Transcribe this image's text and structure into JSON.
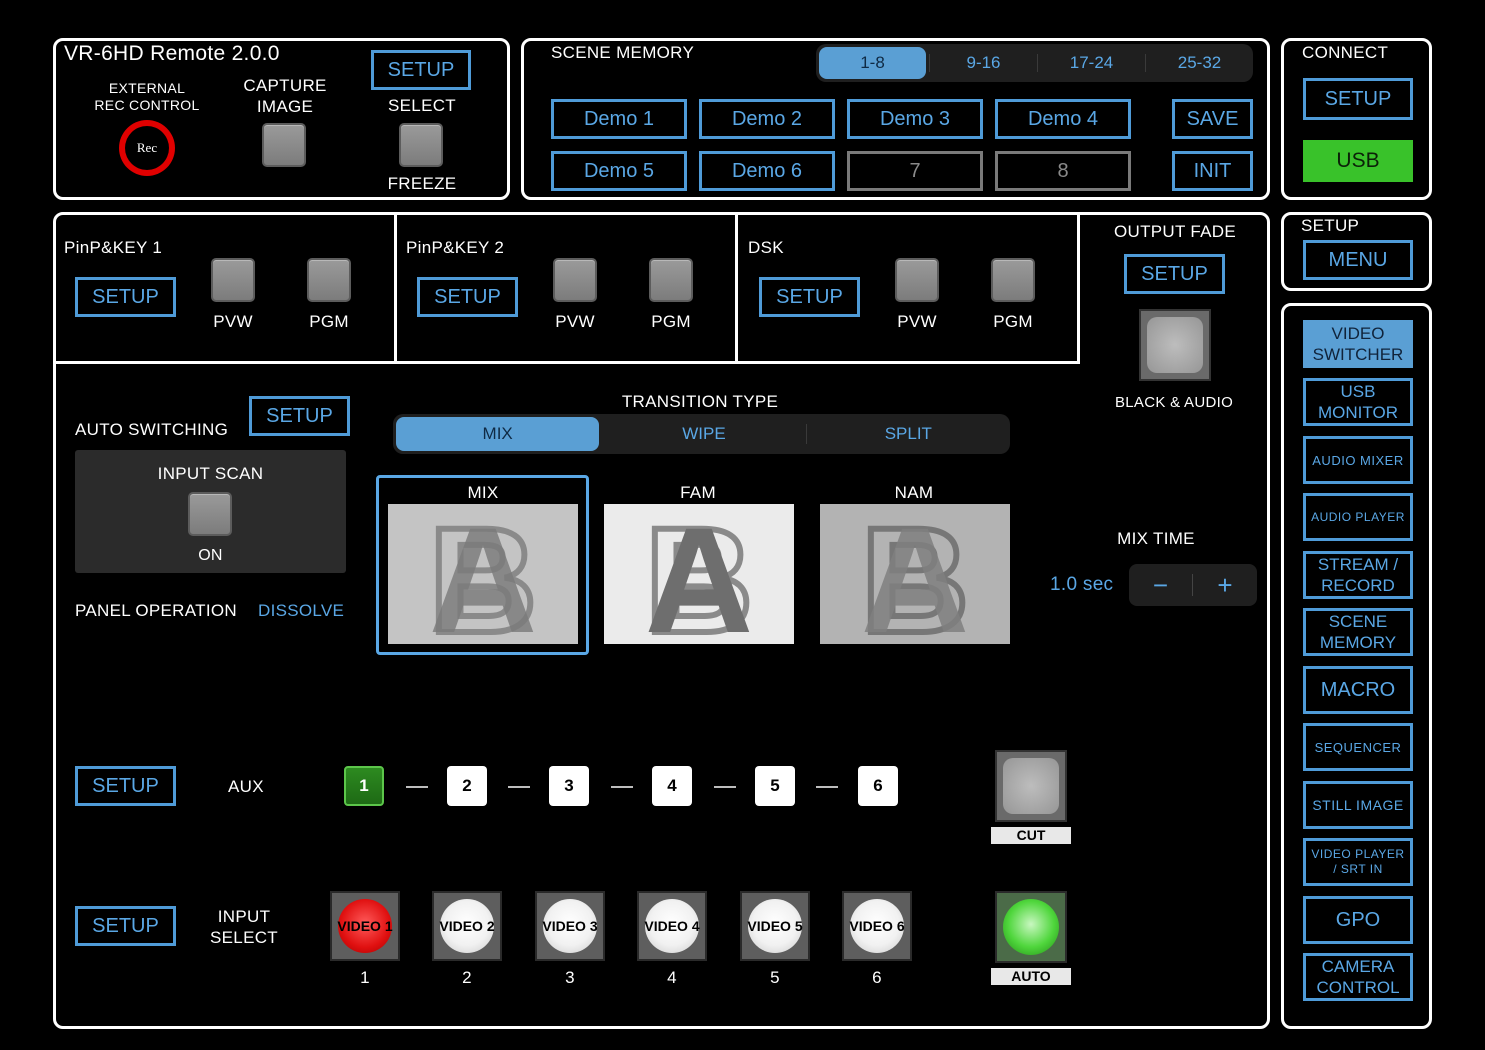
{
  "colors": {
    "accent": "#5aa7e5",
    "accent_fill": "#5a9fd4",
    "usb_green": "#39c22a",
    "rec_red": "#d40000",
    "input_active": "#e01010",
    "aux_active": "#2d8a20"
  },
  "header": {
    "title": "VR-6HD Remote 2.0.0",
    "ext_rec_line1": "EXTERNAL",
    "ext_rec_line2": "REC CONTROL",
    "rec_label": "Rec",
    "capture_line1": "CAPTURE",
    "capture_line2": "IMAGE",
    "setup_label": "SETUP",
    "select_label": "SELECT",
    "freeze_label": "FREEZE"
  },
  "scene": {
    "title": "SCENE MEMORY",
    "tabs": [
      "1-8",
      "9-16",
      "17-24",
      "25-32"
    ],
    "active_tab": "1-8",
    "slots": [
      "Demo 1",
      "Demo 2",
      "Demo 3",
      "Demo 4",
      "Demo 5",
      "Demo 6",
      "7",
      "8"
    ],
    "save_label": "SAVE",
    "init_label": "INIT"
  },
  "connect": {
    "title": "CONNECT",
    "setup_label": "SETUP",
    "usb_label": "USB"
  },
  "setup_menu": {
    "title": "SETUP",
    "menu_label": "MENU"
  },
  "keys": [
    {
      "title": "PinP&KEY 1",
      "setup": "SETUP",
      "pvw": "PVW",
      "pgm": "PGM"
    },
    {
      "title": "PinP&KEY 2",
      "setup": "SETUP",
      "pvw": "PVW",
      "pgm": "PGM"
    },
    {
      "title": "DSK",
      "setup": "SETUP",
      "pvw": "PVW",
      "pgm": "PGM"
    }
  ],
  "output_fade": {
    "title": "OUTPUT FADE",
    "setup_label": "SETUP",
    "caption": "BLACK & AUDIO"
  },
  "auto_switching": {
    "title": "AUTO SWITCHING",
    "setup_label": "SETUP",
    "input_scan": "INPUT SCAN",
    "state": "ON"
  },
  "panel_operation": {
    "label": "PANEL OPERATION",
    "value": "DISSOLVE"
  },
  "transition": {
    "title": "TRANSITION TYPE",
    "options": [
      "MIX",
      "WIPE",
      "SPLIT"
    ],
    "active": "MIX",
    "modes": [
      "MIX",
      "FAM",
      "NAM"
    ],
    "selected_mode": "MIX"
  },
  "mix_time": {
    "label": "MIX TIME",
    "value": "1.0 sec",
    "minus": "−",
    "plus": "+"
  },
  "aux": {
    "setup_label": "SETUP",
    "label": "AUX",
    "channels": [
      "1",
      "2",
      "3",
      "4",
      "5",
      "6"
    ],
    "active": "1"
  },
  "cut_label": "CUT",
  "auto_label": "AUTO",
  "input_select": {
    "setup_label": "SETUP",
    "label_line1": "INPUT",
    "label_line2": "SELECT",
    "buttons": [
      "VIDEO 1",
      "VIDEO 2",
      "VIDEO 3",
      "VIDEO 4",
      "VIDEO 5",
      "VIDEO 6"
    ],
    "numbers": [
      "1",
      "2",
      "3",
      "4",
      "5",
      "6"
    ],
    "active": "VIDEO 1"
  },
  "sidebar": {
    "items": [
      {
        "line1": "VIDEO",
        "line2": "SWITCHER",
        "active": true
      },
      {
        "line1": "USB",
        "line2": "MONITOR"
      },
      {
        "line1": "AUDIO MIXER",
        "line2": ""
      },
      {
        "line1": "AUDIO PLAYER",
        "line2": ""
      },
      {
        "line1": "STREAM /",
        "line2": "RECORD"
      },
      {
        "line1": "SCENE",
        "line2": "MEMORY"
      },
      {
        "line1": "MACRO",
        "line2": ""
      },
      {
        "line1": "SEQUENCER",
        "line2": ""
      },
      {
        "line1": "STILL IMAGE",
        "line2": ""
      },
      {
        "line1": "VIDEO PLAYER",
        "line2": "/ SRT IN"
      },
      {
        "line1": "GPO",
        "line2": ""
      },
      {
        "line1": "CAMERA",
        "line2": "CONTROL"
      }
    ]
  }
}
